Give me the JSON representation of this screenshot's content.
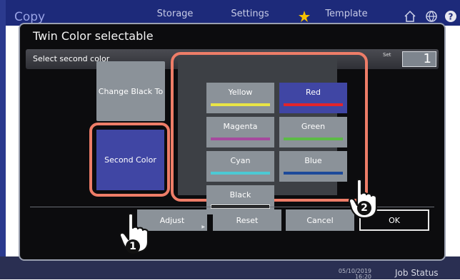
{
  "app": {
    "title": "Copy",
    "tabs": [
      "Storage",
      "Settings",
      "Template"
    ],
    "status_date": "05/10/2019",
    "status_time": "16:20",
    "job_status": "Job Status"
  },
  "dialog": {
    "title": "Twin Color selectable",
    "subtitle": "Select second color",
    "set_label": "Set",
    "set_value": "1",
    "change_black_to": "Change Black To",
    "second_color": "Second Color",
    "colors": [
      {
        "label": "Yellow",
        "bar": "#e9e545",
        "selected": false
      },
      {
        "label": "Red",
        "bar": "#e3242b",
        "selected": true
      },
      {
        "label": "Magenta",
        "bar": "#a64a9e",
        "selected": false
      },
      {
        "label": "Green",
        "bar": "#5cbb46",
        "selected": false
      },
      {
        "label": "Cyan",
        "bar": "#4cc9d4",
        "selected": false
      },
      {
        "label": "Blue",
        "bar": "#1d4a9a",
        "selected": false
      },
      {
        "label": "Black",
        "bar": "#000000",
        "selected": false
      }
    ],
    "buttons": {
      "adjust": "Adjust",
      "reset": "Reset",
      "cancel": "Cancel",
      "ok": "OK"
    }
  },
  "callouts": [
    "1",
    "2"
  ],
  "colors": {
    "highlight": "#ee7d68",
    "selected": "#4046a4",
    "button": "#8b9299"
  }
}
